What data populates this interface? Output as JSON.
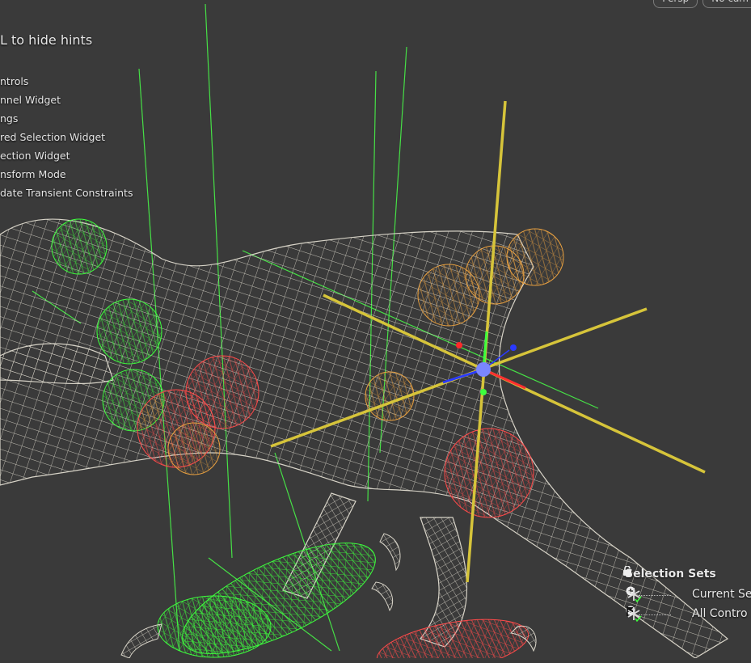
{
  "viewport": {
    "camera_buttons": [
      "Persp",
      "No cam"
    ]
  },
  "hints": {
    "title": "L to hide hints",
    "items": [
      "ntrols",
      "nnel Widget",
      "ngs",
      "red Selection Widget",
      "ection Widget",
      "nsform Mode",
      "date Transient Constraints"
    ]
  },
  "selection_sets": {
    "header": "Selection Sets",
    "rows": [
      {
        "label": "Current Se"
      },
      {
        "label": "All Contro"
      }
    ]
  },
  "colors": {
    "background": "#3a3a3a",
    "wireframe": "#d8d4c8",
    "green_handle": "#3dff3d",
    "red_handle": "#ff4a4a",
    "orange_handle": "#e8a040",
    "yellow_axis": "#d6c43a"
  },
  "icons": [
    "lock-icon",
    "plus-circle-icon",
    "asterisk-icon",
    "flag-icon"
  ]
}
